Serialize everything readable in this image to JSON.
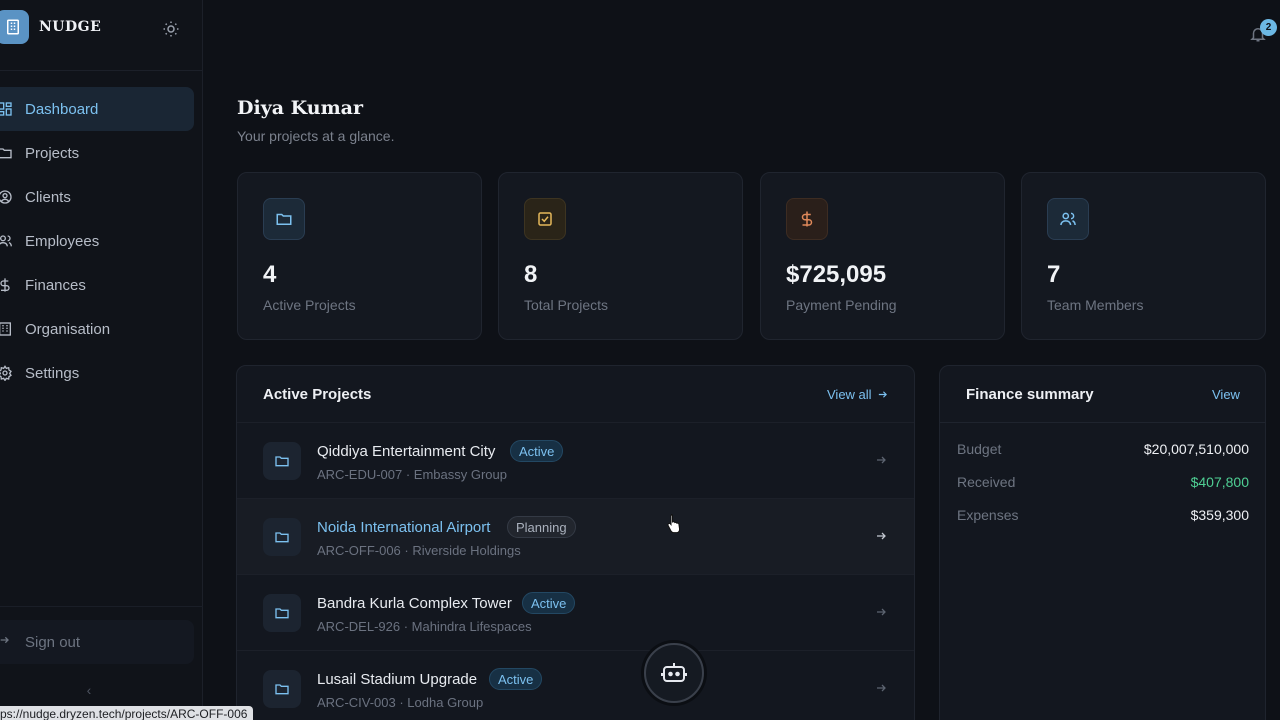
{
  "app": {
    "name": "NUDGE"
  },
  "sidebar": {
    "items": [
      {
        "label": "Dashboard",
        "icon": "layout-grid-icon",
        "active": true
      },
      {
        "label": "Projects",
        "icon": "folder-icon"
      },
      {
        "label": "Clients",
        "icon": "user-circle-icon"
      },
      {
        "label": "Employees",
        "icon": "users-icon"
      },
      {
        "label": "Finances",
        "icon": "dollar-icon"
      },
      {
        "label": "Organisation",
        "icon": "building-icon"
      },
      {
        "label": "Settings",
        "icon": "gear-icon"
      }
    ],
    "sign_out": "Sign out",
    "collapse": "‹"
  },
  "header": {
    "notification_count": "2"
  },
  "page": {
    "title": "Diya Kumar",
    "subtitle": "Your projects at a glance."
  },
  "stats": [
    {
      "value": "4",
      "label": "Active Projects",
      "icon": "folder-icon",
      "color": "#7cc1f0"
    },
    {
      "value": "8",
      "label": "Total Projects",
      "icon": "check-square-icon",
      "color": "#e5b85a"
    },
    {
      "value": "$725,095",
      "label": "Payment Pending",
      "icon": "dollar-icon",
      "color": "#e0895a"
    },
    {
      "value": "7",
      "label": "Team Members",
      "icon": "users-icon",
      "color": "#7cc1f0"
    }
  ],
  "projects_panel": {
    "title": "Active Projects",
    "view_all": "View all",
    "rows": [
      {
        "name": "Qiddiya Entertainment City",
        "status": "Active",
        "meta": "ARC-EDU-007 · Embassy Group"
      },
      {
        "name": "Noida International Airport",
        "status": "Planning",
        "meta": "ARC-OFF-006 · Riverside Holdings"
      },
      {
        "name": "Bandra Kurla Complex Tower",
        "status": "Active",
        "meta": "ARC-DEL-926 · Mahindra Lifespaces"
      },
      {
        "name": "Lusail Stadium Upgrade",
        "status": "Active",
        "meta": "ARC-CIV-003 · Lodha Group"
      }
    ]
  },
  "finance_panel": {
    "title": "Finance summary",
    "view": "View",
    "rows": [
      {
        "label": "Budget",
        "value": "$20,007,510,000"
      },
      {
        "label": "Received",
        "value": "$407,800"
      },
      {
        "label": "Expenses",
        "value": "$359,300"
      }
    ]
  },
  "status_bar": {
    "url": "ps://nudge.dryzen.tech/projects/ARC-OFF-006"
  }
}
